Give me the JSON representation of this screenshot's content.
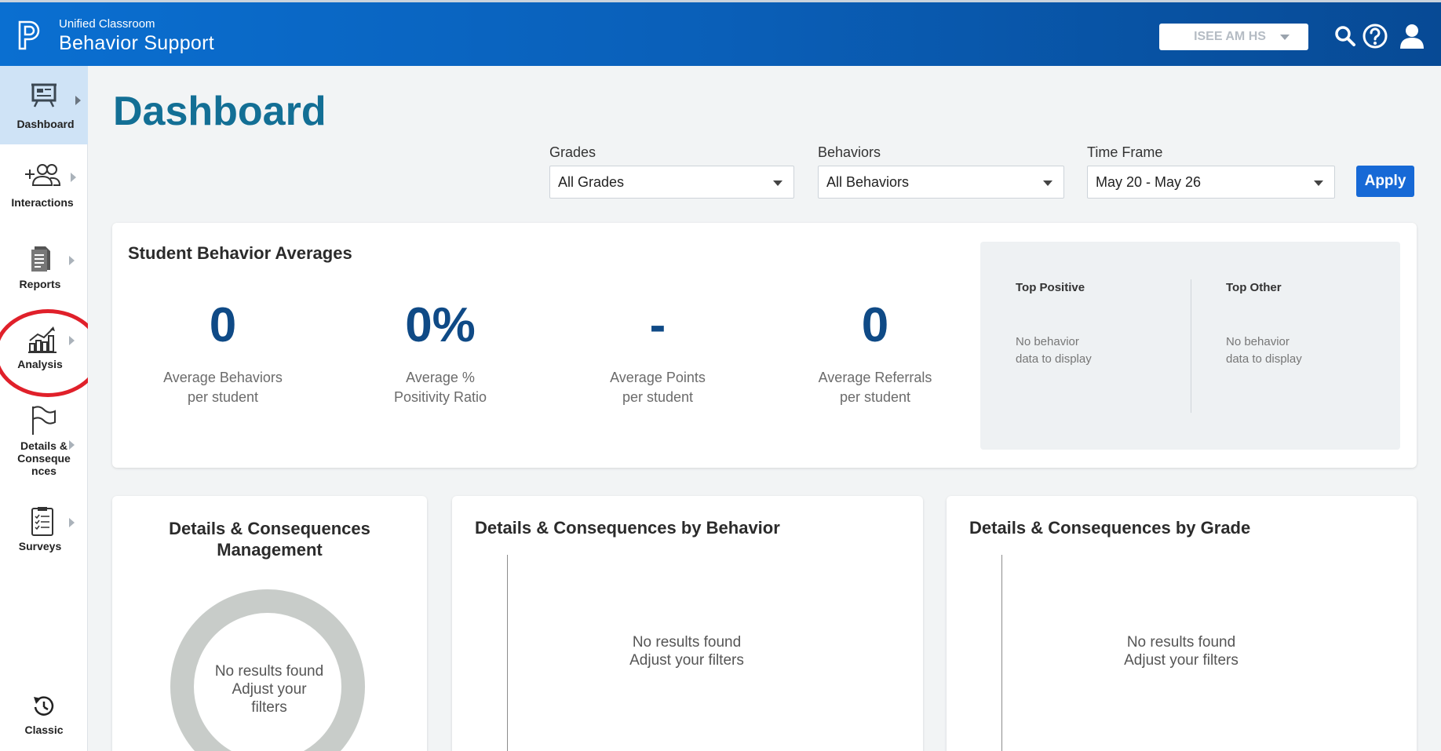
{
  "header": {
    "brand_sub": "Unified Classroom",
    "brand_main": "Behavior Support",
    "school": "ISEE AM HS",
    "colors": {
      "bar_start": "#0a6fd1",
      "bar_end": "#074a95"
    }
  },
  "sidebar": {
    "items": [
      {
        "label": "Dashboard",
        "icon": "presentation-board-icon",
        "active": true
      },
      {
        "label": "Interactions",
        "icon": "add-users-icon"
      },
      {
        "label": "Reports",
        "icon": "document-icon"
      },
      {
        "label": "Analysis",
        "icon": "bar-chart-trend-icon"
      },
      {
        "label": "Details & Conseque nces",
        "icon": "flag-icon"
      },
      {
        "label": "Surveys",
        "icon": "clipboard-checklist-icon"
      }
    ],
    "classic_label": "Classic"
  },
  "main": {
    "title": "Dashboard",
    "filters": {
      "grades_label": "Grades",
      "grades_value": "All Grades",
      "behaviors_label": "Behaviors",
      "behaviors_value": "All Behaviors",
      "timeframe_label": "Time Frame",
      "timeframe_value": "May 20 - May 26",
      "apply_label": "Apply"
    },
    "averages": {
      "title": "Student Behavior Averages",
      "metrics": [
        {
          "value": "0",
          "label_1": "Average Behaviors",
          "label_2": "per student"
        },
        {
          "value": "0%",
          "label_1": "Average %",
          "label_2": "Positivity Ratio"
        },
        {
          "value": "-",
          "label_1": "Average Points",
          "label_2": "per student"
        },
        {
          "value": "0",
          "label_1": "Average Referrals",
          "label_2": "per student"
        }
      ],
      "top_positive": {
        "title": "Top Positive",
        "empty_1": "No behavior",
        "empty_2": "data to display"
      },
      "top_other": {
        "title": "Top Other",
        "empty_1": "No behavior",
        "empty_2": "data to display"
      }
    },
    "cards": {
      "management": {
        "title_1": "Details & Consequences",
        "title_2": "Management",
        "empty_1": "No results found",
        "empty_2": "Adjust your",
        "empty_3": "filters"
      },
      "by_behavior": {
        "title": "Details & Consequences by Behavior",
        "empty_1": "No results found",
        "empty_2": "Adjust your filters"
      },
      "by_grade": {
        "title": "Details & Consequences by Grade",
        "empty_1": "No results found",
        "empty_2": "Adjust your filters"
      }
    }
  },
  "annotations": {
    "color": "#e0202a"
  }
}
